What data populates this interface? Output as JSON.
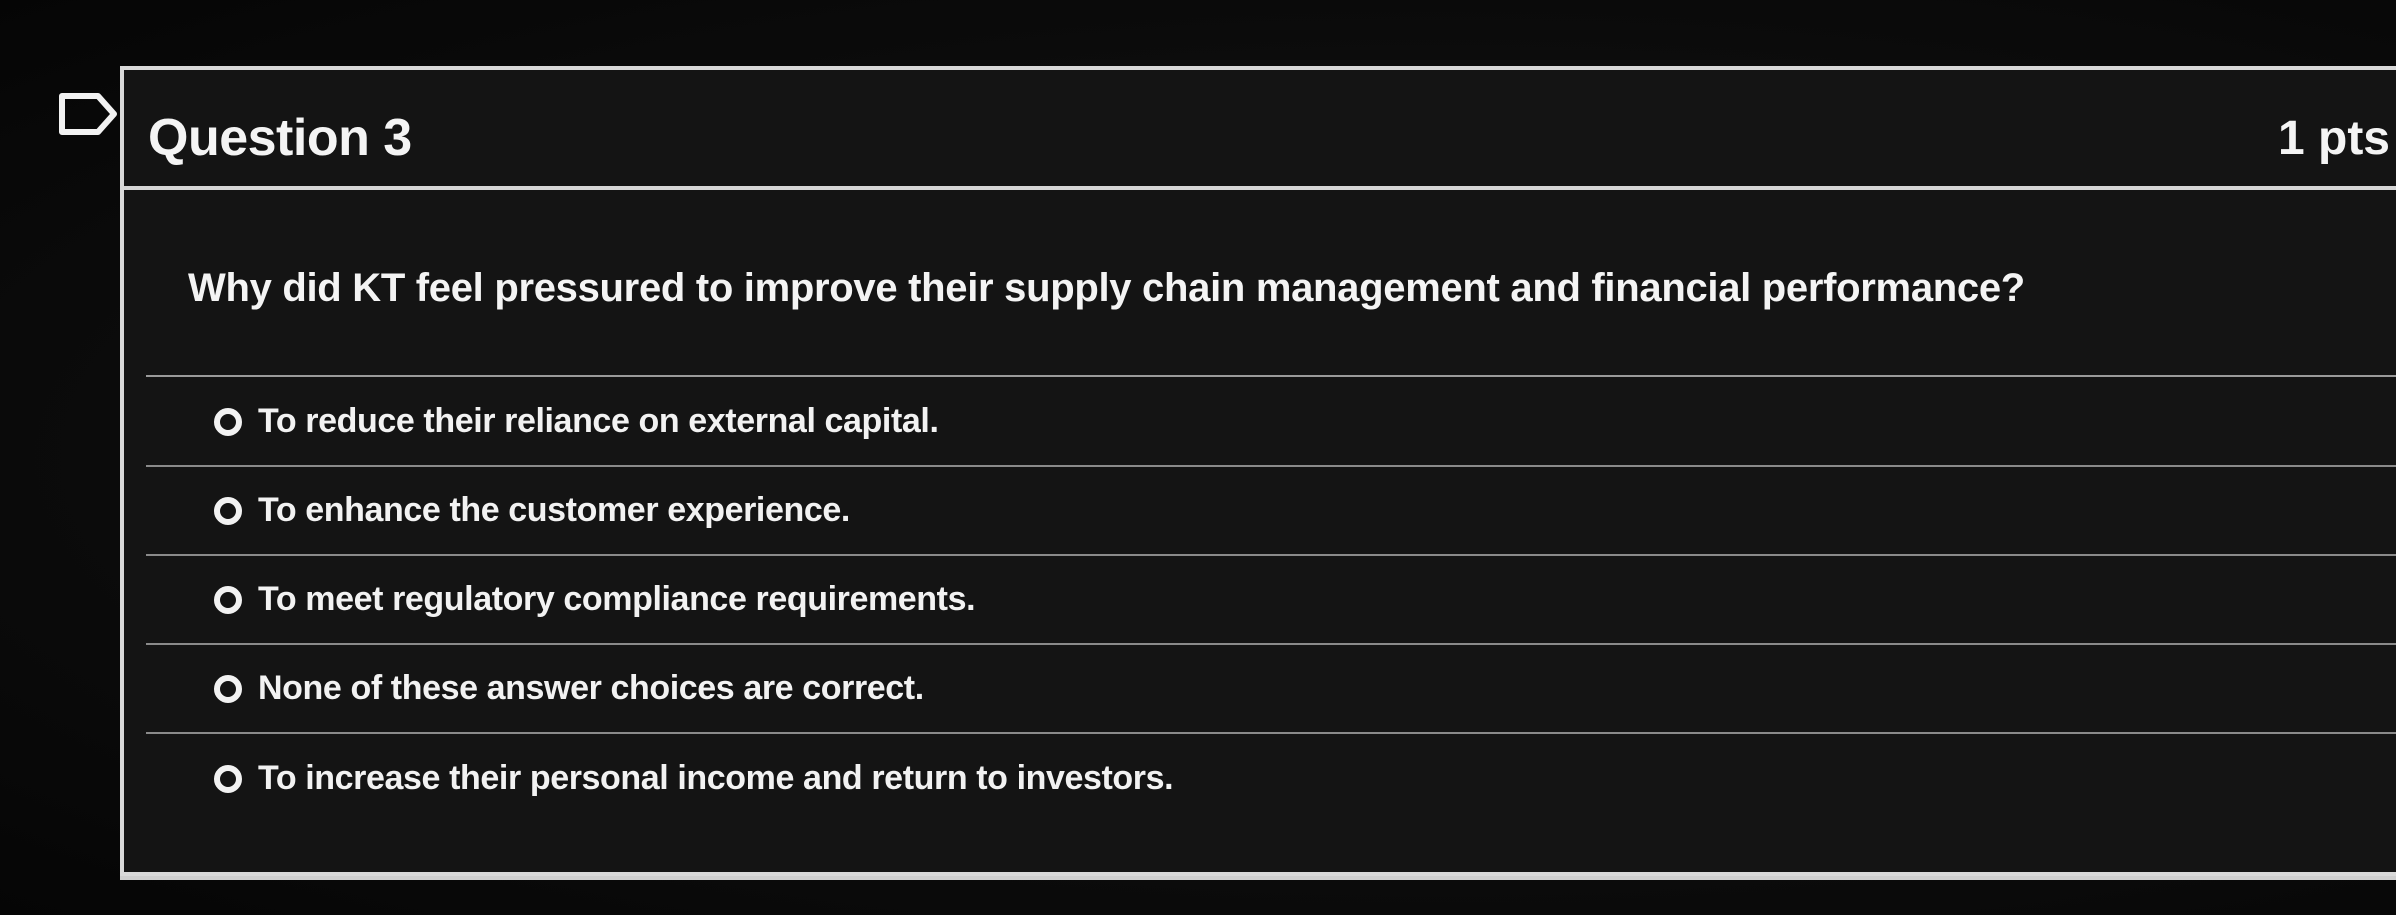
{
  "question": {
    "title": "Question 3",
    "points": "1 pts",
    "text": "Why did KT feel pressured to improve their supply chain management and financial performance?"
  },
  "answers": [
    {
      "label": "To reduce their reliance on external capital."
    },
    {
      "label": "To enhance the customer experience."
    },
    {
      "label": "To meet regulatory compliance requirements."
    },
    {
      "label": "None of these answer choices are correct."
    },
    {
      "label": "To increase their personal income and return to investors."
    }
  ],
  "icons": {
    "flag": "flag-icon",
    "radio": "radio-unchecked-icon"
  },
  "colors": {
    "background": "#0b0b0b",
    "card": "#141414",
    "text": "#f2f2f2",
    "divider": "#d6d6d6"
  }
}
